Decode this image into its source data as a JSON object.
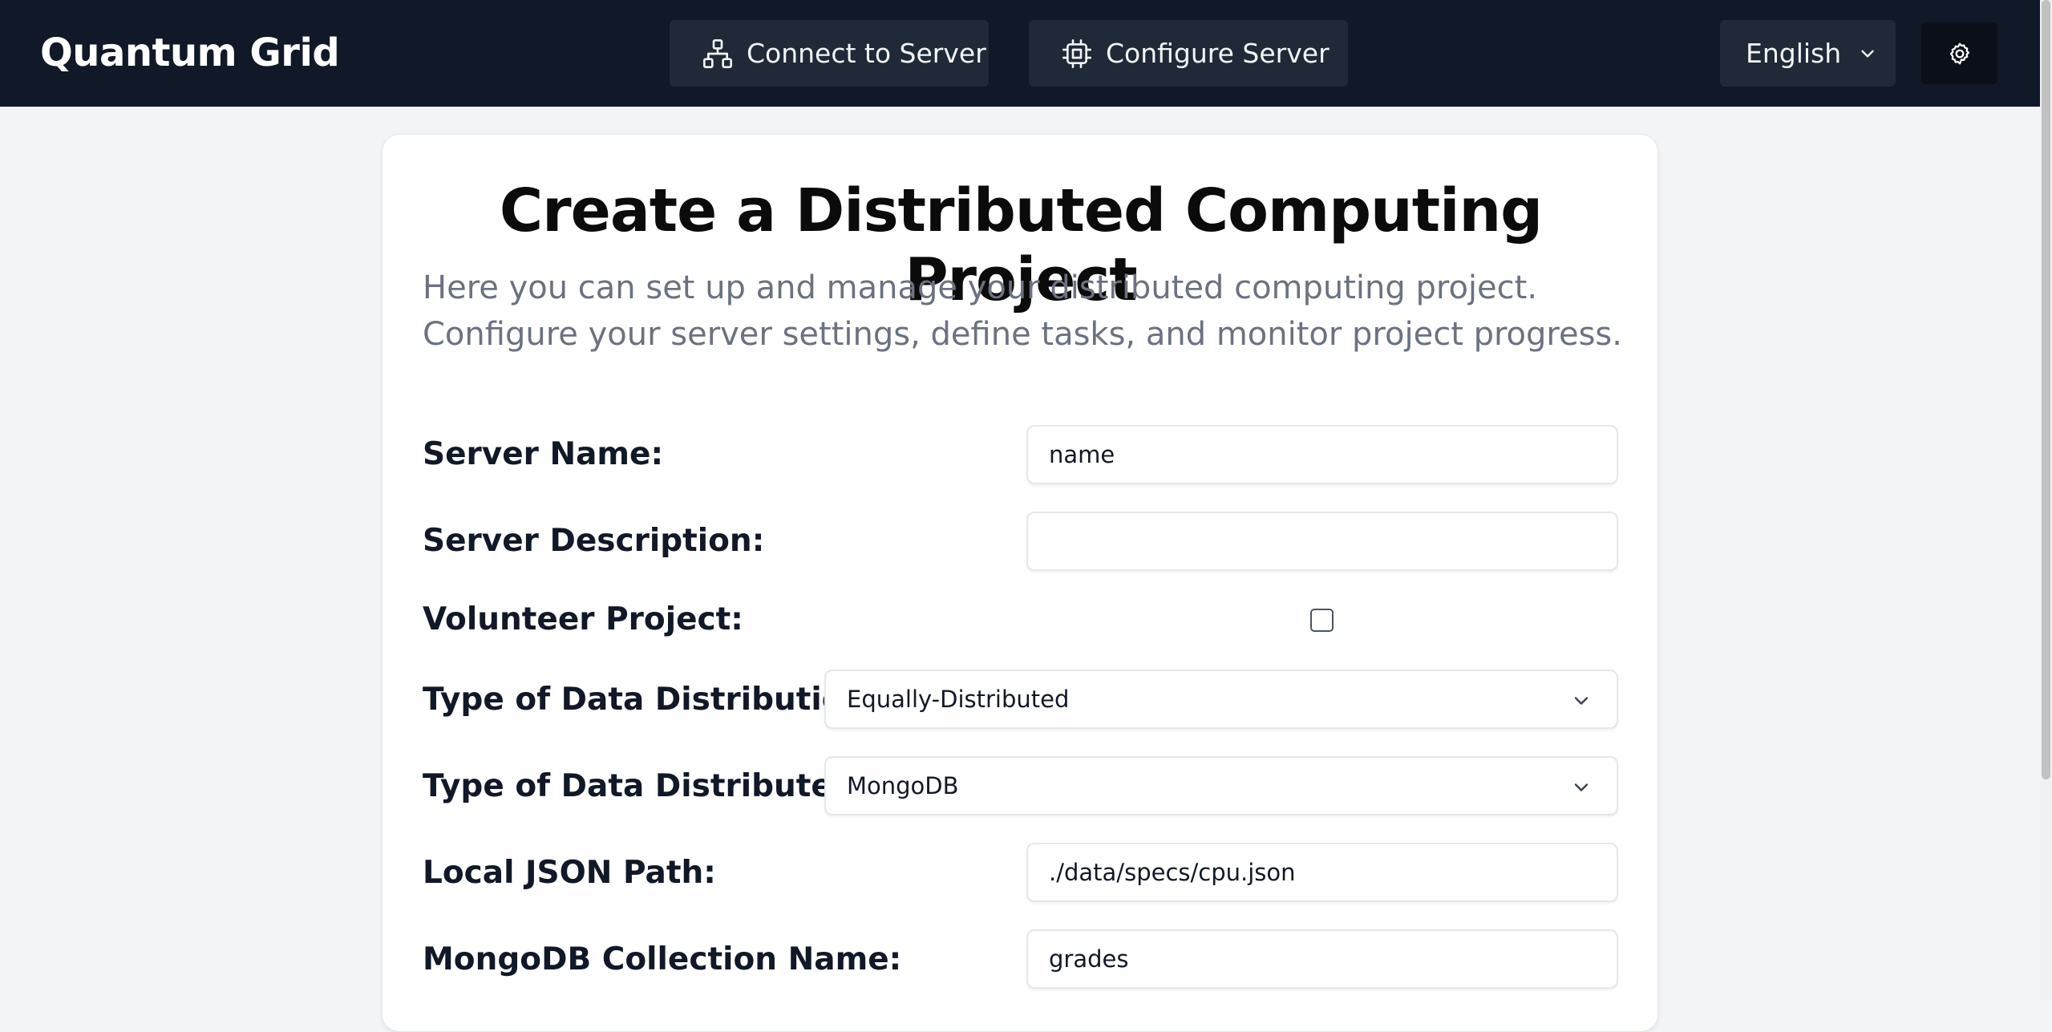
{
  "navbar": {
    "brand": "Quantum Grid",
    "connect_label": "Connect to Server",
    "configure_label": "Configure Server",
    "language": "English",
    "bg_color": "#111827"
  },
  "main": {
    "title": "Create a Distributed Computing Project",
    "description": "Here you can set up and manage your distributed computing project. Configure your server settings, define tasks, and monitor project progress.",
    "fields": {
      "server_name": {
        "label": "Server Name:",
        "value": "name"
      },
      "server_description": {
        "label": "Server Description:",
        "value": ""
      },
      "volunteer_project": {
        "label": "Volunteer Project:",
        "checked": false
      },
      "data_distribution_type": {
        "label": "Type of Data Distribution:",
        "selected": "Equally-Distributed"
      },
      "data_distributed_type": {
        "label": "Type of Data Distributed:",
        "selected": "MongoDB"
      },
      "local_json_path": {
        "label": "Local JSON Path:",
        "value": "./data/specs/cpu.json"
      },
      "mongodb_collection": {
        "label": "MongoDB Collection Name:",
        "value": "grades"
      }
    }
  },
  "icons": {
    "connect": "network-icon",
    "configure": "cpu-icon",
    "language_dropdown": "chevron-down-icon",
    "settings": "gear-icon"
  }
}
